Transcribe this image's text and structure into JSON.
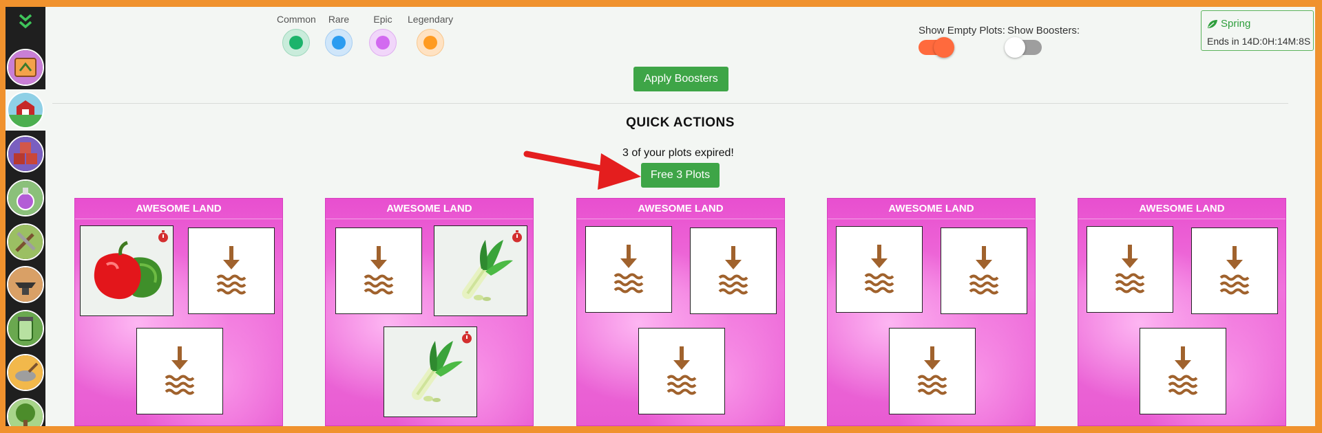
{
  "legend": [
    {
      "label": "Common",
      "color": "#1cb36b",
      "ring": "#c9ecdb"
    },
    {
      "label": "Rare",
      "color": "#2b9cf0",
      "ring": "#cfe6fa"
    },
    {
      "label": "Epic",
      "color": "#d26af0",
      "ring": "#f1d6fa"
    },
    {
      "label": "Legendary",
      "color": "#ff9b21",
      "ring": "#ffe2c2"
    }
  ],
  "toggles": {
    "empty_plots": {
      "label": "Show Empty Plots:",
      "on": true
    },
    "boosters": {
      "label": "Show Boosters:",
      "on": false
    }
  },
  "season": {
    "name": "Spring",
    "ends": "Ends in 14D:0H:14M:8S"
  },
  "apply_boosters": "Apply Boosters",
  "quick_actions": {
    "title": "QUICK ACTIONS",
    "expired_text": "3 of your plots expired!",
    "free_button": "Free 3 Plots"
  },
  "cards": [
    {
      "title": "AWESOME LAND",
      "slots": [
        "pepper",
        "empty",
        "empty"
      ]
    },
    {
      "title": "AWESOME LAND",
      "slots": [
        "empty",
        "leek",
        "leek"
      ]
    },
    {
      "title": "AWESOME LAND",
      "slots": [
        "empty",
        "empty",
        "empty"
      ]
    },
    {
      "title": "AWESOME LAND",
      "slots": [
        "empty",
        "empty",
        "empty"
      ]
    },
    {
      "title": "AWESOME LAND",
      "slots": [
        "empty",
        "empty",
        "empty"
      ]
    }
  ],
  "colors": {
    "accent_green": "#3ea547",
    "toggle_on": "#ff6a3d",
    "frame_orange": "#f0922e"
  }
}
